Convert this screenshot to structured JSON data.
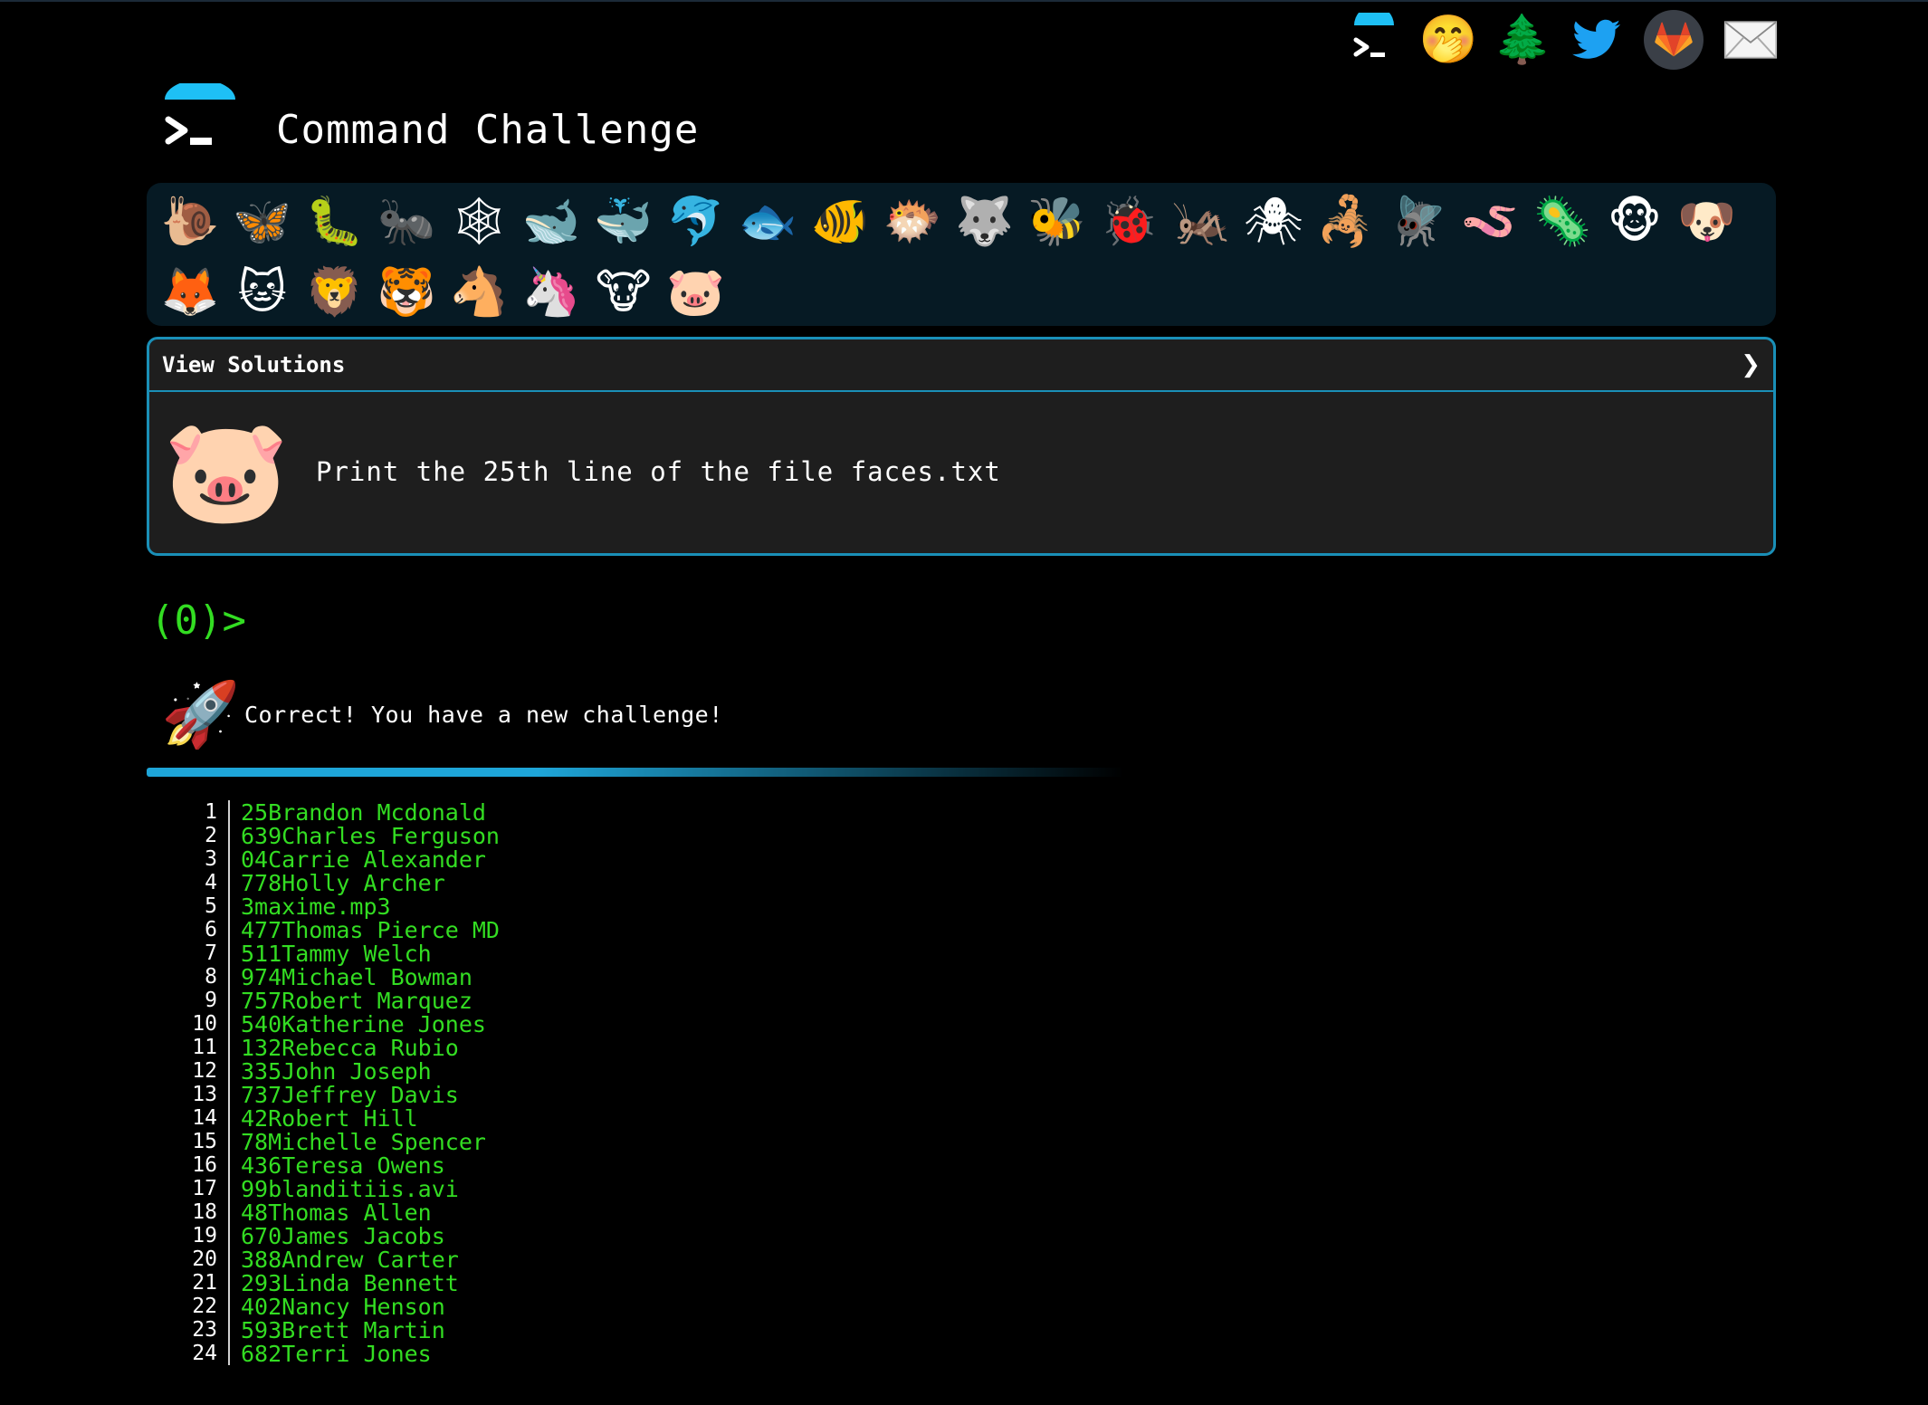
{
  "header": {
    "title": "Command Challenge"
  },
  "top_icons": [
    {
      "name": "terminal-icon",
      "glyph": ">_"
    },
    {
      "name": "shush-face-icon",
      "glyph": "🤭"
    },
    {
      "name": "tree-icon",
      "glyph": "🌲"
    },
    {
      "name": "twitter-icon",
      "glyph": "🐦"
    },
    {
      "name": "gitlab-icon",
      "glyph": "🦊"
    },
    {
      "name": "mail-icon",
      "glyph": "✉"
    }
  ],
  "animals": [
    {
      "name": "snail",
      "glyph": "🐌"
    },
    {
      "name": "butterfly",
      "glyph": "🦋"
    },
    {
      "name": "caterpillar",
      "glyph": "🐛"
    },
    {
      "name": "ant",
      "glyph": "🐜"
    },
    {
      "name": "spider-web",
      "glyph": "🕸"
    },
    {
      "name": "whale",
      "glyph": "🐋"
    },
    {
      "name": "spouting-whale",
      "glyph": "🐳"
    },
    {
      "name": "dolphin",
      "glyph": "🐬"
    },
    {
      "name": "fish",
      "glyph": "🐟"
    },
    {
      "name": "tropical-fish",
      "glyph": "🐠"
    },
    {
      "name": "blowfish",
      "glyph": "🐡"
    },
    {
      "name": "wolf",
      "glyph": "🐺"
    },
    {
      "name": "bee",
      "glyph": "🐝"
    },
    {
      "name": "ladybug",
      "glyph": "🐞"
    },
    {
      "name": "cricket",
      "glyph": "🦗"
    },
    {
      "name": "spider",
      "glyph": "🕷"
    },
    {
      "name": "scorpion",
      "glyph": "🦂"
    },
    {
      "name": "fly",
      "glyph": "🪰"
    },
    {
      "name": "worm",
      "glyph": "🪱"
    },
    {
      "name": "microbe",
      "glyph": "🦠"
    },
    {
      "name": "monkey",
      "glyph": "🐵"
    },
    {
      "name": "dog",
      "glyph": "🐶"
    },
    {
      "name": "fox",
      "glyph": "🦊"
    },
    {
      "name": "cat",
      "glyph": "🐱"
    },
    {
      "name": "lion",
      "glyph": "🦁"
    },
    {
      "name": "tiger",
      "glyph": "🐯"
    },
    {
      "name": "horse",
      "glyph": "🐴"
    },
    {
      "name": "unicorn",
      "glyph": "🦄"
    },
    {
      "name": "cow",
      "glyph": "🐮"
    },
    {
      "name": "pig",
      "glyph": "🐷"
    }
  ],
  "panel": {
    "header_label": "View Solutions",
    "chevron": "❯",
    "icon": "🐷",
    "task": "Print the 25th line of the file faces.txt"
  },
  "prompt": {
    "text": "(0)>"
  },
  "result": {
    "icon": "🚀",
    "message": "Correct! You have a new challenge!"
  },
  "output_lines": [
    {
      "n": "1",
      "text": "25Brandon Mcdonald"
    },
    {
      "n": "2",
      "text": "639Charles Ferguson"
    },
    {
      "n": "3",
      "text": "04Carrie Alexander"
    },
    {
      "n": "4",
      "text": "778Holly Archer"
    },
    {
      "n": "5",
      "text": "3maxime.mp3"
    },
    {
      "n": "6",
      "text": "477Thomas Pierce MD"
    },
    {
      "n": "7",
      "text": "511Tammy Welch"
    },
    {
      "n": "8",
      "text": "974Michael Bowman"
    },
    {
      "n": "9",
      "text": "757Robert Marquez"
    },
    {
      "n": "10",
      "text": "540Katherine Jones"
    },
    {
      "n": "11",
      "text": "132Rebecca Rubio"
    },
    {
      "n": "12",
      "text": "335John Joseph"
    },
    {
      "n": "13",
      "text": "737Jeffrey Davis"
    },
    {
      "n": "14",
      "text": "42Robert Hill"
    },
    {
      "n": "15",
      "text": "78Michelle Spencer"
    },
    {
      "n": "16",
      "text": "436Teresa Owens"
    },
    {
      "n": "17",
      "text": "99blanditiis.avi"
    },
    {
      "n": "18",
      "text": "48Thomas Allen"
    },
    {
      "n": "19",
      "text": "670James Jacobs"
    },
    {
      "n": "20",
      "text": "388Andrew Carter"
    },
    {
      "n": "21",
      "text": "293Linda Bennett"
    },
    {
      "n": "22",
      "text": "402Nancy Henson"
    },
    {
      "n": "23",
      "text": "593Brett Martin"
    },
    {
      "n": "24",
      "text": "682Terri Jones"
    }
  ],
  "colors": {
    "background": "#000000",
    "accent": "#1a8fb7",
    "prompt_green": "#33dd22",
    "panel_bg": "#1e1e1e",
    "animal_strip_bg": "#061a24"
  }
}
